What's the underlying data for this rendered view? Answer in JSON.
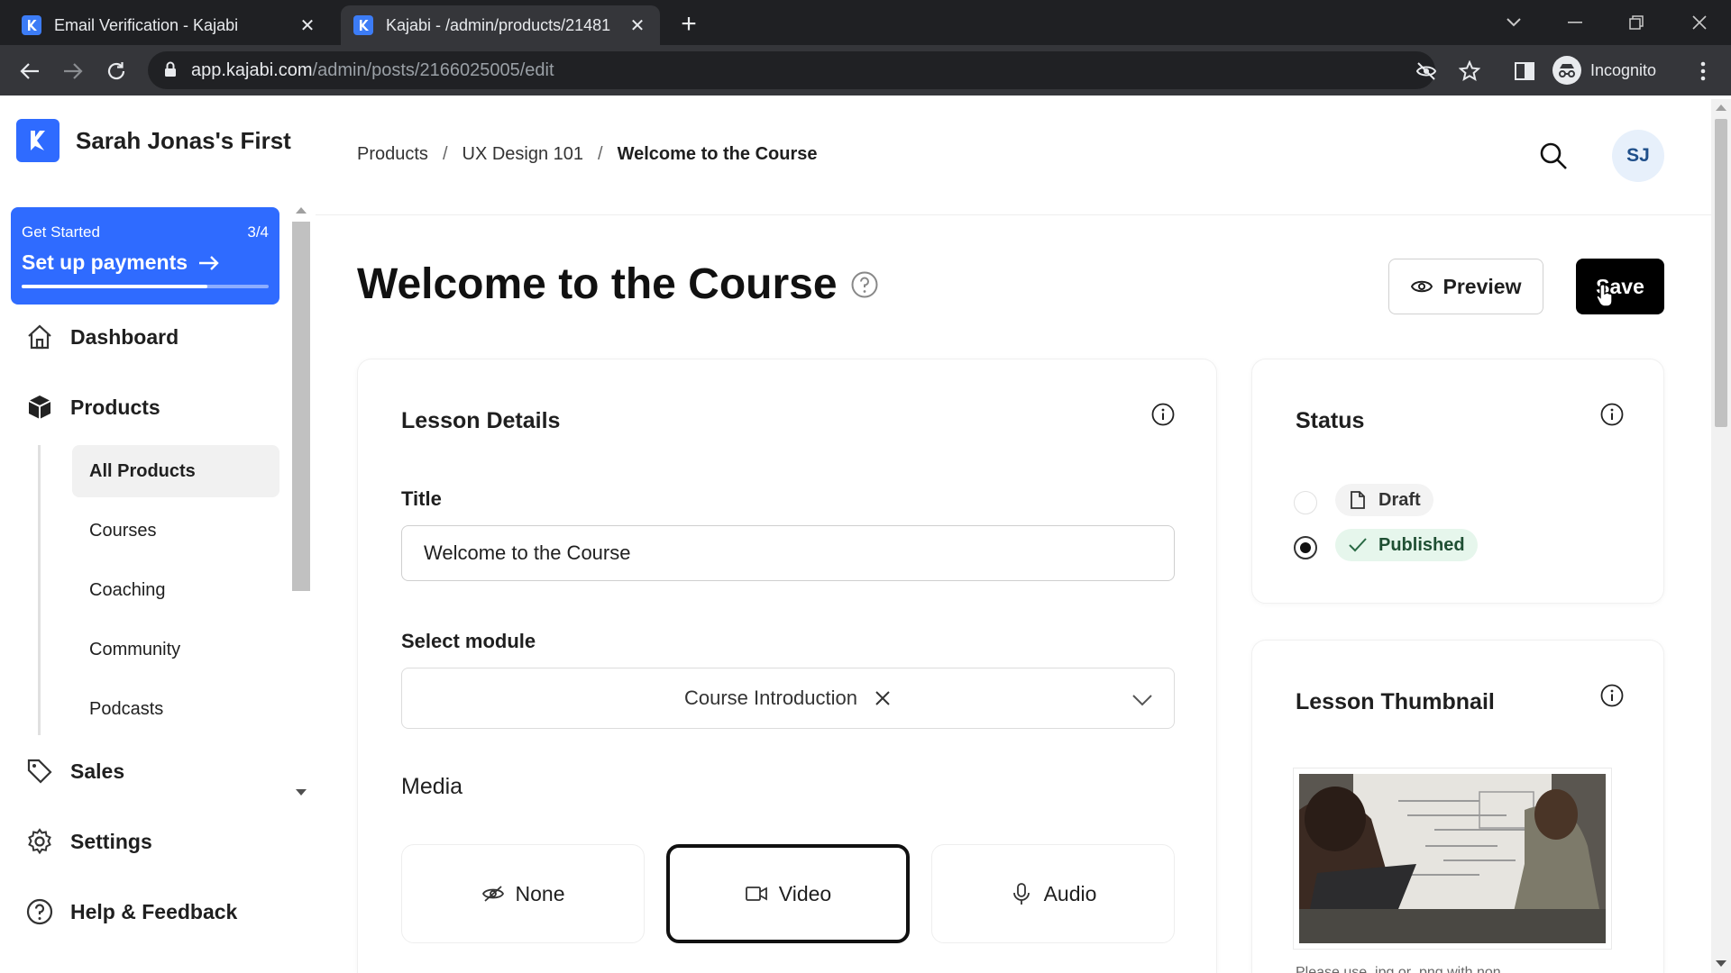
{
  "browser": {
    "tabs": [
      {
        "title": "Email Verification - Kajabi",
        "active": false
      },
      {
        "title": "Kajabi - /admin/products/21481",
        "active": true
      }
    ],
    "new_tab": "+",
    "url_host": "app.kajabi.com",
    "url_path": "/admin/posts/2166025005/edit",
    "profile_label": "Incognito"
  },
  "sidebar": {
    "site_name": "Sarah Jonas's First",
    "get_started": {
      "label": "Get Started",
      "progress_text": "3/4",
      "progress_fraction": 0.75,
      "cta": "Set up payments"
    },
    "nav": {
      "dashboard": "Dashboard",
      "products": "Products",
      "sales": "Sales",
      "settings": "Settings",
      "help": "Help & Feedback"
    },
    "products_sub": [
      "All Products",
      "Courses",
      "Coaching",
      "Community",
      "Podcasts"
    ]
  },
  "header": {
    "breadcrumb": [
      "Products",
      "UX Design 101",
      "Welcome to the Course"
    ],
    "separator": "/",
    "avatar_initials": "SJ"
  },
  "page": {
    "title": "Welcome to the Course",
    "preview_label": "Preview",
    "save_label": "Save"
  },
  "lesson_details": {
    "heading": "Lesson Details",
    "title_label": "Title",
    "title_value": "Welcome to the Course",
    "module_label": "Select module",
    "module_value": "Course Introduction",
    "media_label": "Media",
    "media_options": [
      "None",
      "Video",
      "Audio"
    ],
    "media_selected": "Video"
  },
  "status": {
    "heading": "Status",
    "options": [
      "Draft",
      "Published"
    ],
    "selected": "Published"
  },
  "thumbnail": {
    "heading": "Lesson Thumbnail",
    "note": "Please use .jpg or .png with non"
  },
  "colors": {
    "brand_blue": "#2f6bff",
    "published_bg": "#e6f6ec",
    "save_bg": "#000000"
  }
}
